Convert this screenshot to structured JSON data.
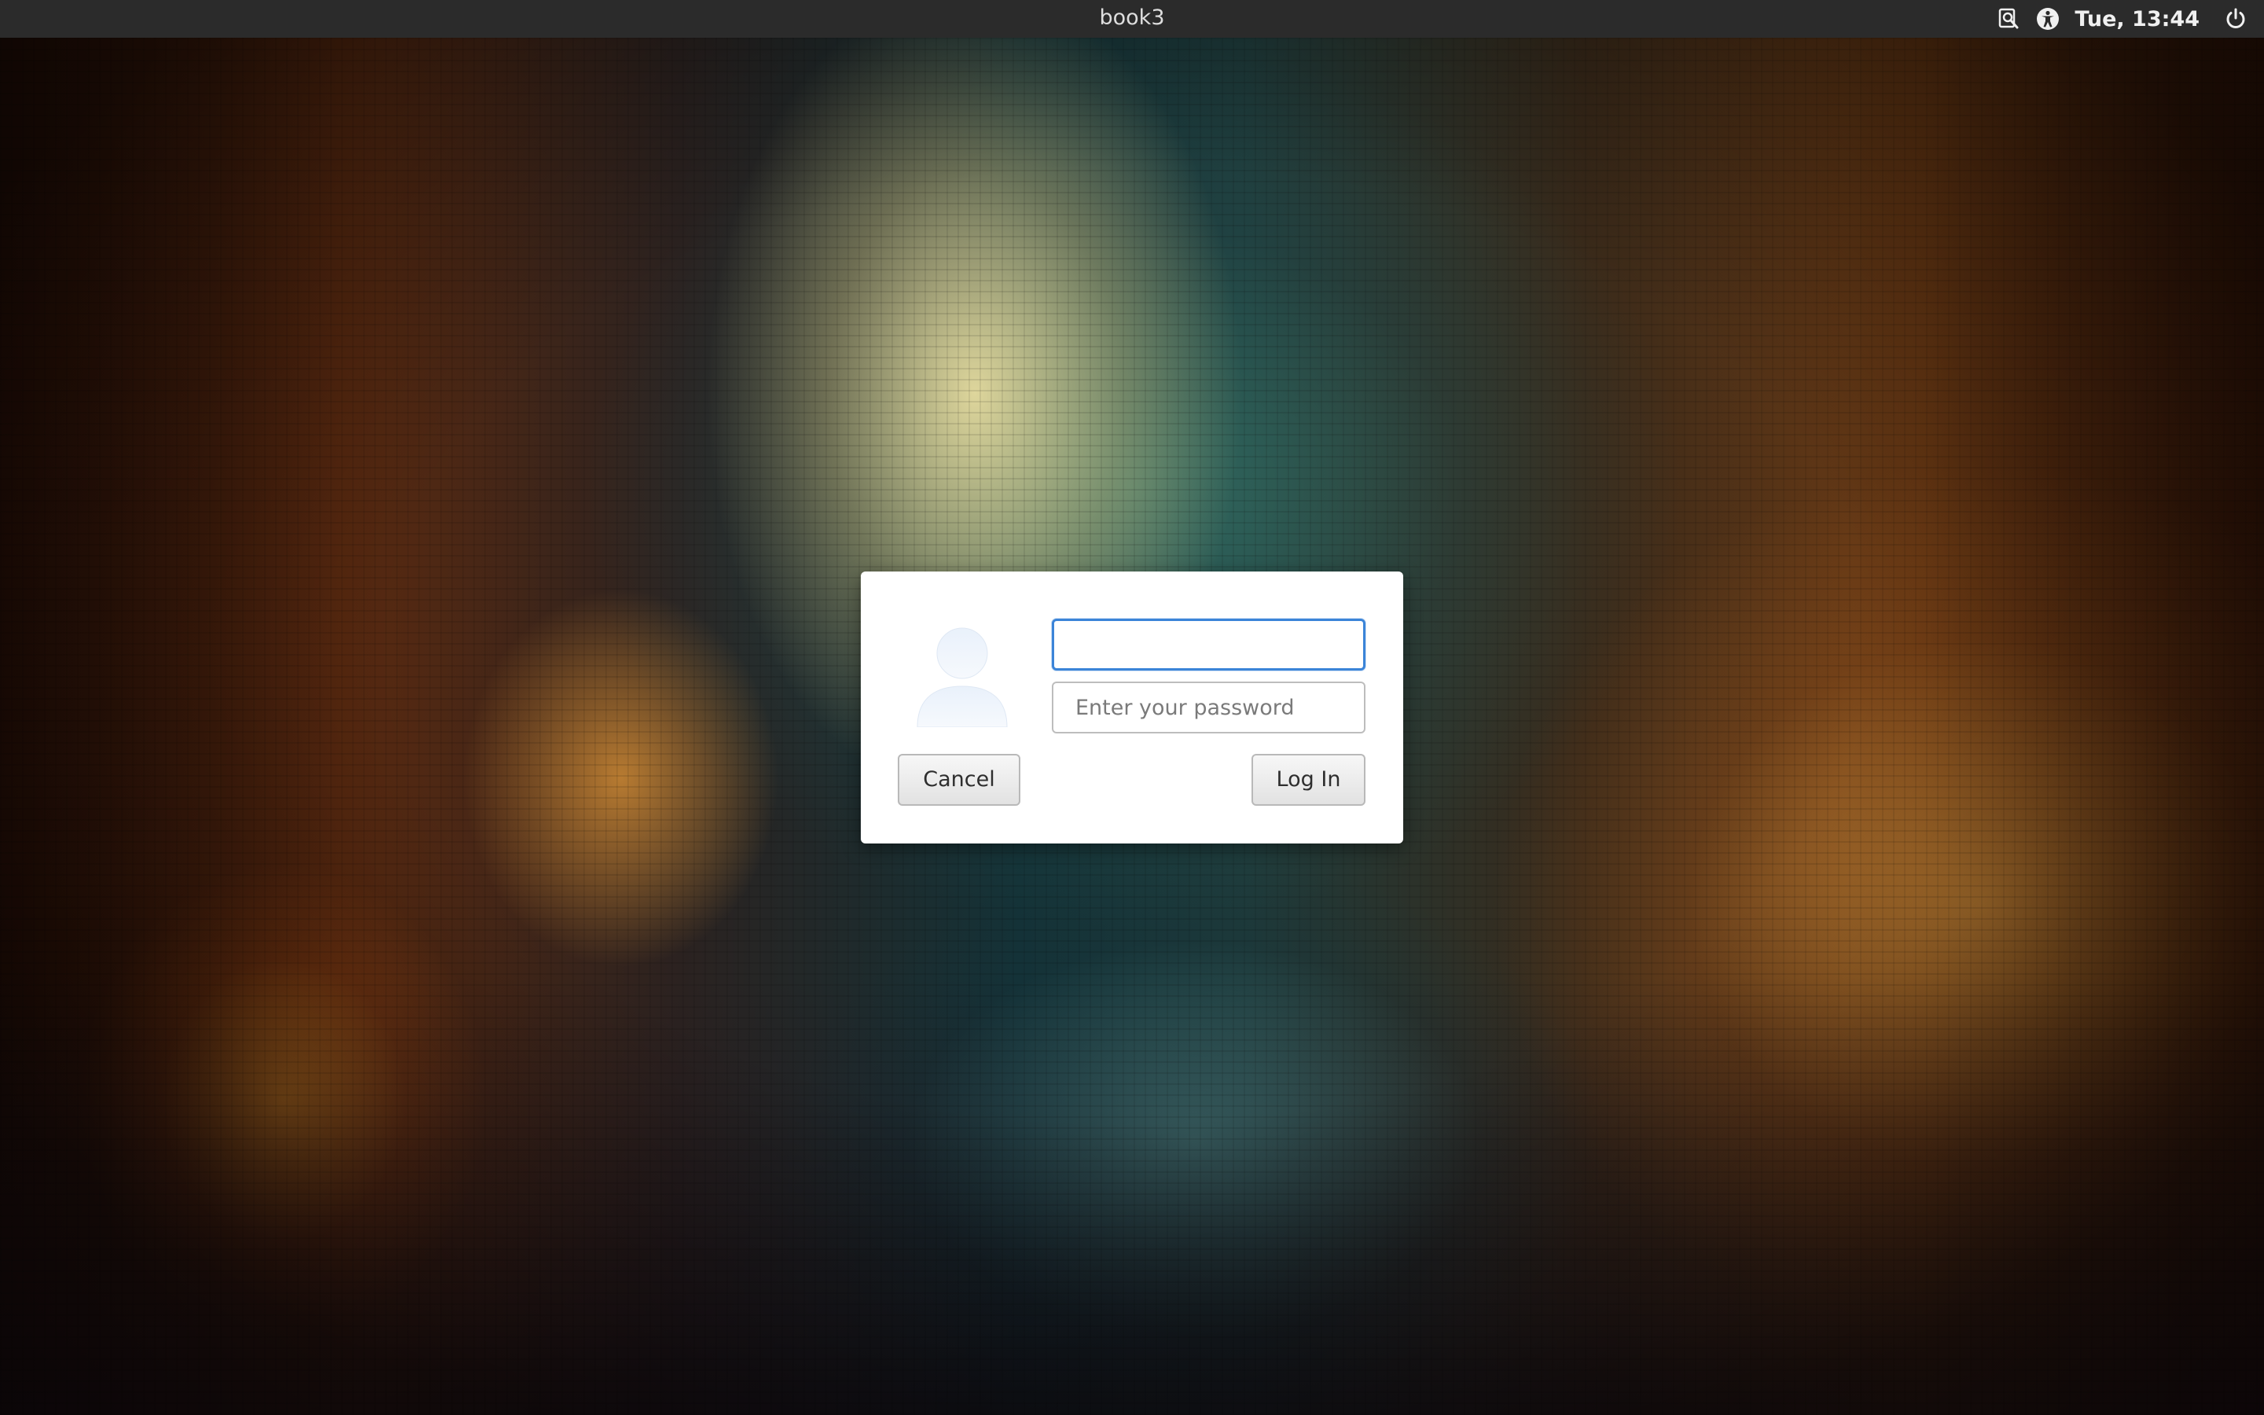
{
  "top_bar": {
    "hostname": "book3",
    "clock": "Tue, 13:44",
    "icons": [
      "screen-reader-icon",
      "accessibility-icon",
      "power-icon"
    ]
  },
  "login_dialog": {
    "avatar_icon": "user-avatar-icon",
    "username": {
      "value": "",
      "placeholder": ""
    },
    "password": {
      "value": "",
      "placeholder": "Enter your password"
    },
    "cancel_label": "Cancel",
    "login_label": "Log In"
  },
  "colors": {
    "top_bar_bg": "#2b2b2b",
    "focus_ring": "#3b84d8",
    "dialog_bg": "#ffffff"
  }
}
